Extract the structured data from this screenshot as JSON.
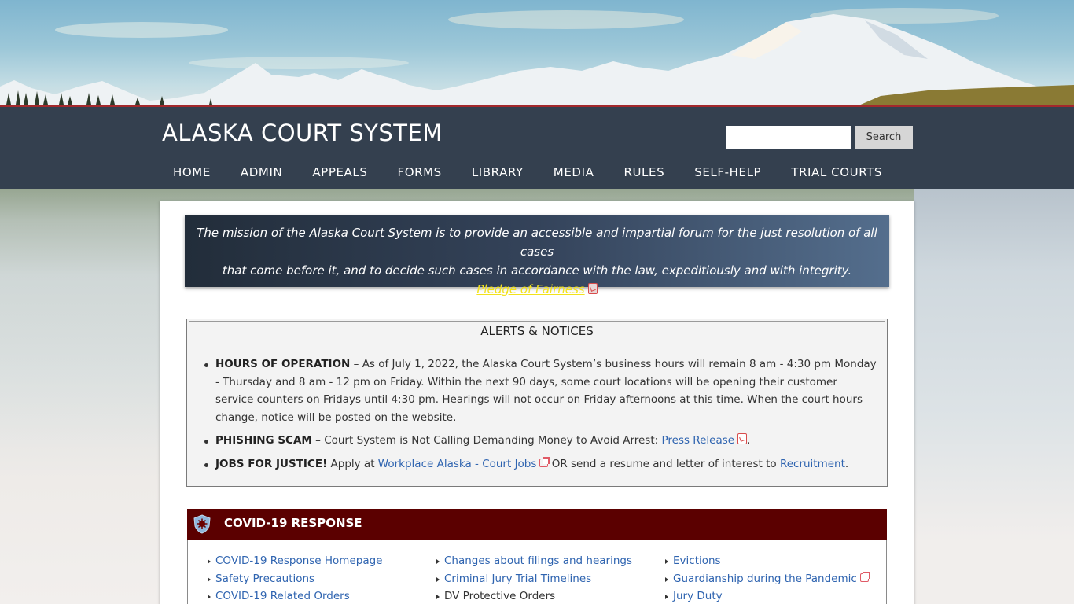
{
  "header": {
    "site_title": "ALASKA COURT SYSTEM",
    "search": {
      "placeholder": "",
      "value": "",
      "button_label": "Search"
    },
    "nav": [
      "HOME",
      "ADMIN",
      "APPEALS",
      "FORMS",
      "LIBRARY",
      "MEDIA",
      "RULES",
      "SELF-HELP",
      "TRIAL COURTS"
    ]
  },
  "mission": {
    "line1": "The mission of the Alaska Court System is to provide an accessible and impartial forum for the just resolution of all cases",
    "line2": "that come before it, and to decide such cases in accordance with the law, expeditiously and with integrity.",
    "pledge_link": "Pledge of Fairness",
    "pledge_icon": "pdf-icon"
  },
  "alerts": {
    "title": "ALERTS & NOTICES",
    "items": [
      {
        "label": "HOURS OF OPERATION",
        "text": " – As of July 1, 2022, the Alaska Court System’s business hours will remain 8 am - 4:30 pm Monday - Thursday and 8 am - 12 pm on Friday. Within the next 90 days, some court locations will be opening their customer service counters on Fridays until 4:30 pm. Hearings will not occur on Friday afternoons at this time. When the court hours change, notice will be posted on the website."
      },
      {
        "label": "PHISHING SCAM",
        "text": " – Court System is Not Calling Demanding Money to Avoid Arrest: ",
        "link": "Press Release",
        "link_icon": "pdf-icon",
        "after": "."
      },
      {
        "label": "JOBS FOR JUSTICE!",
        "text": " Apply at ",
        "link": "Workplace Alaska - Court Jobs",
        "link_icon": "external-link-icon",
        "middle": " OR send a resume and letter of interest to ",
        "link2": "Recruitment",
        "after": "."
      }
    ]
  },
  "covid": {
    "title": "COVID-19 RESPONSE",
    "icon": "virus-shield-icon",
    "columns": [
      [
        {
          "label": "COVID-19 Response Homepage",
          "link": true
        },
        {
          "label": "Safety Precautions",
          "link": true
        },
        {
          "label": "COVID-19 Related Orders",
          "link": true
        }
      ],
      [
        {
          "label": "Changes about filings and hearings",
          "link": true
        },
        {
          "label": "Criminal Jury Trial Timelines",
          "link": true
        },
        {
          "label": "DV Protective Orders",
          "link": false
        }
      ],
      [
        {
          "label": "Evictions",
          "link": true
        },
        {
          "label": "Guardianship during the Pandemic",
          "link": true,
          "icon": "external-link-icon"
        },
        {
          "label": "Jury Duty",
          "link": true
        }
      ]
    ]
  },
  "colors": {
    "header_bg": "#34404f",
    "accent_red": "#a3282c",
    "covid_header": "#5b0000",
    "link": "#2f64b0",
    "pledge_link": "#f2e21c"
  }
}
